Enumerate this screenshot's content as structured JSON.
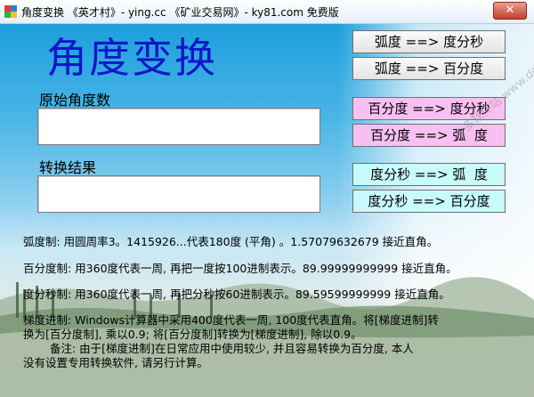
{
  "window": {
    "title": "角度变换  《英才村》- ying.cc  《矿业交易网》- ky81.com  免费版",
    "close_label": "✕"
  },
  "header": {
    "title": "角度变换"
  },
  "inputs": {
    "original_label": "原始角度数",
    "original_value": "",
    "result_label": "转换结果",
    "result_value": ""
  },
  "buttons": {
    "rad_to_dms": "弧度 ==> 度分秒",
    "rad_to_deg": "弧度 ==> 百分度",
    "deg_to_dms": "百分度 ==> 度分秒",
    "deg_to_rad": "百分度 ==> 弧  度",
    "dms_to_rad": "度分秒 ==> 弧  度",
    "dms_to_deg": "度分秒 ==> 百分度"
  },
  "notes": {
    "radian": "弧度制: 用圆周率3。1415926...代表180度 (平角) 。1.57079632679 接近直角。",
    "percent": "百分度制: 用360度代表一周, 再把一度按100进制表示。89.99999999999 接近直角。",
    "dms": "度分秒制: 用360度代表一周, 再把分秒按60进制表示。89.59599999999 接近直角。",
    "gradian_1": "梯度进制: Windows计算器中采用400度代表一周, 100度代表直角。将[梯度进制]转",
    "gradian_2": "换为[百分度制], 乘以0.9; 将[百分度制]转换为[梯度进制], 除以0.9。",
    "remark_1": "备注: 由于[梯度进制]在日常应用中使用较少, 并且容易转换为百分度, 本人",
    "remark_2": "没有设置专用转换软件, 请另行计算。"
  },
  "watermark": "多多软件站 www.ddooo.com",
  "colors": {
    "title_blue": "#1016c8",
    "pink_button": "#f8c0f2",
    "cyan_button": "#c8fbfb"
  }
}
